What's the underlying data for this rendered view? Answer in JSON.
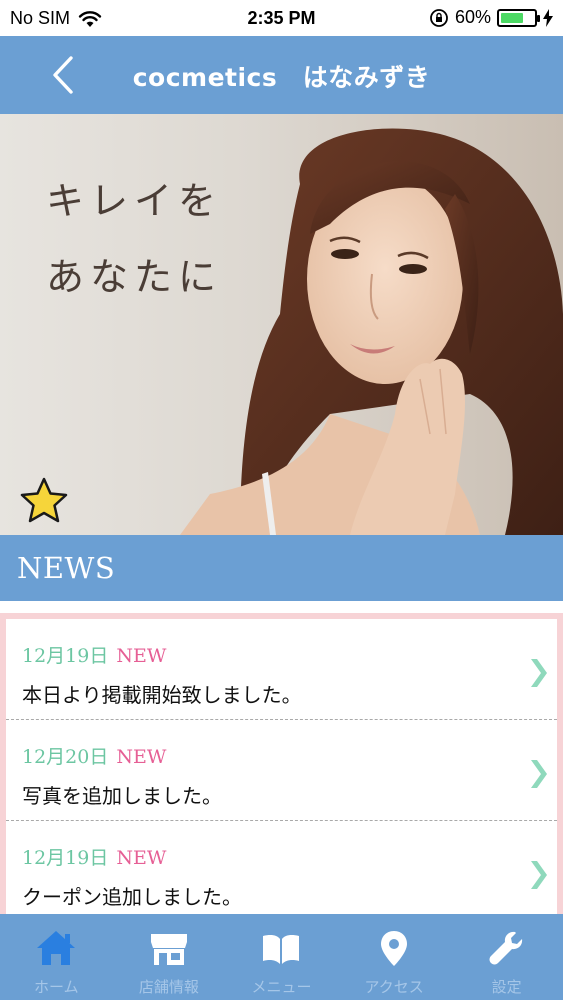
{
  "status_bar": {
    "carrier": "No SIM",
    "time": "2:35 PM",
    "battery_text": "60%",
    "battery_level": 0.6
  },
  "header": {
    "title": "cocmetics　はなみずき",
    "back_icon": "chevron-left-icon"
  },
  "hero": {
    "line1": "キレイを",
    "line2": "あなたに",
    "favorite_icon": "star-icon"
  },
  "news": {
    "title": "NEWS",
    "items": [
      {
        "date": "12月19日",
        "badge": "NEW",
        "text": "本日より掲載開始致しました。"
      },
      {
        "date": "12月20日",
        "badge": "NEW",
        "text": "写真を追加しました。"
      },
      {
        "date": "12月19日",
        "badge": "NEW",
        "text": "クーポン追加しました。"
      }
    ]
  },
  "tabs": [
    {
      "label": "ホーム",
      "icon": "home-icon",
      "active": true
    },
    {
      "label": "店舗情報",
      "icon": "shop-icon",
      "active": false
    },
    {
      "label": "メニュー",
      "icon": "book-icon",
      "active": false
    },
    {
      "label": "アクセス",
      "icon": "map-pin-icon",
      "active": false
    },
    {
      "label": "設定",
      "icon": "wrench-icon",
      "active": false
    }
  ],
  "colors": {
    "accent": "#6b9fd3",
    "active_tab_icon": "#2a7fe0",
    "date": "#6cc6a2",
    "new_badge": "#e65f95",
    "chevron": "#8fd9bc"
  }
}
